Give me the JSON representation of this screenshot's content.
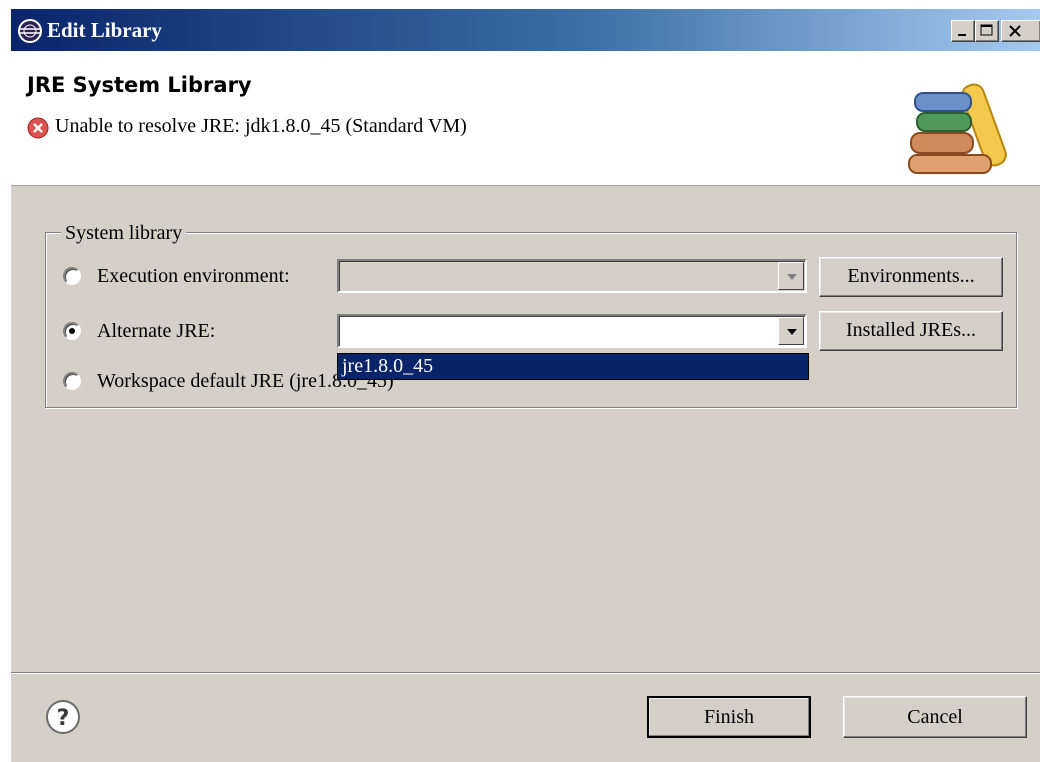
{
  "window": {
    "title": "Edit Library",
    "controls": {
      "minimize": "_",
      "maximize": "□",
      "close": "×"
    }
  },
  "banner": {
    "title": "JRE System Library",
    "message": "Unable to resolve JRE: jdk1.8.0_45 (Standard VM)",
    "message_icon": "error-icon",
    "wizard_icon": "library-books-icon"
  },
  "group": {
    "label": "System library",
    "options": [
      {
        "label": "Execution environment:",
        "selected": false
      },
      {
        "label": "Alternate JRE:",
        "selected": true
      },
      {
        "label": "Workspace default JRE (jre1.8.0_45)",
        "selected": false
      }
    ],
    "execution_env_value": "",
    "alternate_jre_value": "",
    "dropdown_options": [
      "jre1.8.0_45"
    ],
    "buttons": {
      "environments": "Environments...",
      "installed_jres": "Installed JREs..."
    }
  },
  "footer": {
    "help_icon": "help-icon",
    "finish": "Finish",
    "cancel": "Cancel"
  },
  "colors": {
    "title_gradient_start": "#0a246a",
    "title_gradient_end": "#a6caf0",
    "dialog_bg": "#d4d0c8",
    "selection": "#0a246a",
    "error": "#d9534f"
  }
}
